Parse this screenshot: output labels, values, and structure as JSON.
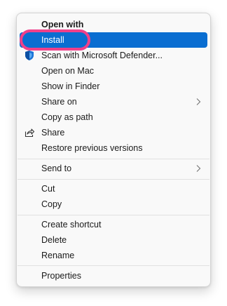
{
  "menu": {
    "header": "Open with",
    "items": [
      {
        "label": "Install",
        "selected": true
      },
      {
        "label": "Scan with Microsoft Defender...",
        "icon": "defender-shield-icon"
      },
      {
        "label": "Open on Mac"
      },
      {
        "label": "Show in Finder"
      },
      {
        "label": "Share on",
        "submenu": true
      },
      {
        "label": "Copy as path"
      },
      {
        "label": "Share",
        "icon": "share-icon"
      },
      {
        "label": "Restore previous versions"
      },
      {
        "label": "Send to",
        "submenu": true
      },
      {
        "label": "Cut"
      },
      {
        "label": "Copy"
      },
      {
        "label": "Create shortcut"
      },
      {
        "label": "Delete"
      },
      {
        "label": "Rename"
      },
      {
        "label": "Properties"
      }
    ]
  },
  "colors": {
    "selection": "#0a6ed1",
    "annotation_ring": "#f0408a",
    "shield": "#1a73d6"
  }
}
